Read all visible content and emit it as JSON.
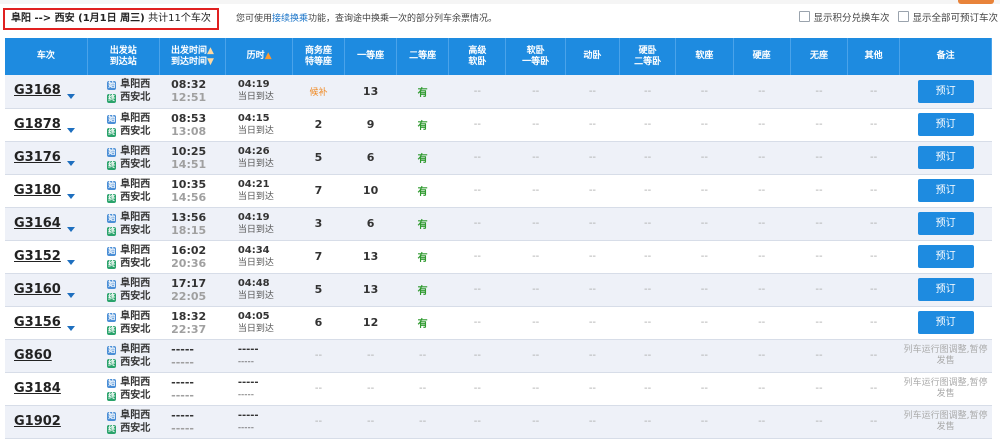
{
  "summary": {
    "route": "阜阳 --> 西安 (1月1日 周三)",
    "count": "共计11个车次",
    "hint_prefix": "您可使用",
    "hint_link": "接续换乘",
    "hint_suffix": "功能，查询途中换乘一次的部分列车余票情况。",
    "opt_points": "显示积分兑换车次",
    "opt_all": "显示全部可预订车次"
  },
  "headers": {
    "train": "车次",
    "station_top": "出发站",
    "station_bottom": "到达站",
    "time_top": "出发时间",
    "time_bottom": "到达时间",
    "duration": "历时",
    "business_top": "商务座",
    "business_bottom": "特等座",
    "first": "一等座",
    "second": "二等座",
    "premium_top": "高级",
    "premium_bottom": "软卧",
    "soft1_top": "软卧",
    "soft1_bottom": "一等卧",
    "emu_sleeper": "动卧",
    "hard2_top": "硬卧",
    "hard2_bottom": "二等卧",
    "soft_seat": "软座",
    "hard_seat": "硬座",
    "no_seat": "无座",
    "other": "其他",
    "remark": "备注"
  },
  "rows": [
    {
      "train": "G3168",
      "from": "阜阳西",
      "to": "西安北",
      "dep": "08:32",
      "arr": "12:51",
      "dur": "04:19",
      "arrive_day": "当日到达",
      "business": "候补",
      "first": "13",
      "second": "有",
      "action": "预订"
    },
    {
      "train": "G1878",
      "from": "阜阳西",
      "to": "西安北",
      "dep": "08:53",
      "arr": "13:08",
      "dur": "04:15",
      "arrive_day": "当日到达",
      "business": "2",
      "first": "9",
      "second": "有",
      "action": "预订"
    },
    {
      "train": "G3176",
      "from": "阜阳西",
      "to": "西安北",
      "dep": "10:25",
      "arr": "14:51",
      "dur": "04:26",
      "arrive_day": "当日到达",
      "business": "5",
      "first": "6",
      "second": "有",
      "action": "预订"
    },
    {
      "train": "G3180",
      "from": "阜阳西",
      "to": "西安北",
      "dep": "10:35",
      "arr": "14:56",
      "dur": "04:21",
      "arrive_day": "当日到达",
      "business": "7",
      "first": "10",
      "second": "有",
      "action": "预订"
    },
    {
      "train": "G3164",
      "from": "阜阳西",
      "to": "西安北",
      "dep": "13:56",
      "arr": "18:15",
      "dur": "04:19",
      "arrive_day": "当日到达",
      "business": "3",
      "first": "6",
      "second": "有",
      "action": "预订"
    },
    {
      "train": "G3152",
      "from": "阜阳西",
      "to": "西安北",
      "dep": "16:02",
      "arr": "20:36",
      "dur": "04:34",
      "arrive_day": "当日到达",
      "business": "7",
      "first": "13",
      "second": "有",
      "action": "预订"
    },
    {
      "train": "G3160",
      "from": "阜阳西",
      "to": "西安北",
      "dep": "17:17",
      "arr": "22:05",
      "dur": "04:48",
      "arrive_day": "当日到达",
      "business": "5",
      "first": "13",
      "second": "有",
      "action": "预订"
    },
    {
      "train": "G3156",
      "from": "阜阳西",
      "to": "西安北",
      "dep": "18:32",
      "arr": "22:37",
      "dur": "04:05",
      "arrive_day": "当日到达",
      "business": "6",
      "first": "12",
      "second": "有",
      "action": "预订"
    },
    {
      "train": "G860",
      "from": "阜阳西",
      "to": "西安北",
      "dep": "-----",
      "arr": "-----",
      "dur": "-----",
      "arrive_day": "-----",
      "business": "--",
      "first": "--",
      "second": "--",
      "remark": "列车运行图调整,暂停发售"
    },
    {
      "train": "G3184",
      "from": "阜阳西",
      "to": "西安北",
      "dep": "-----",
      "arr": "-----",
      "dur": "-----",
      "arrive_day": "-----",
      "business": "--",
      "first": "--",
      "second": "--",
      "remark": "列车运行图调整,暂停发售"
    },
    {
      "train": "G1902",
      "from": "阜阳西",
      "to": "西安北",
      "dep": "-----",
      "arr": "-----",
      "dur": "-----",
      "arrive_day": "-----",
      "business": "--",
      "first": "--",
      "second": "--",
      "remark": "列车运行图调整,暂停发售"
    }
  ],
  "empty_cell": "--",
  "tags": {
    "start": "始",
    "end": "终"
  },
  "colors": {
    "header_blue": "#1e8be0",
    "button_blue": "#1e8be0",
    "available_green": "#2f9a2f",
    "waitlist_orange": "#f08a24",
    "highlight_red": "#e02020"
  }
}
